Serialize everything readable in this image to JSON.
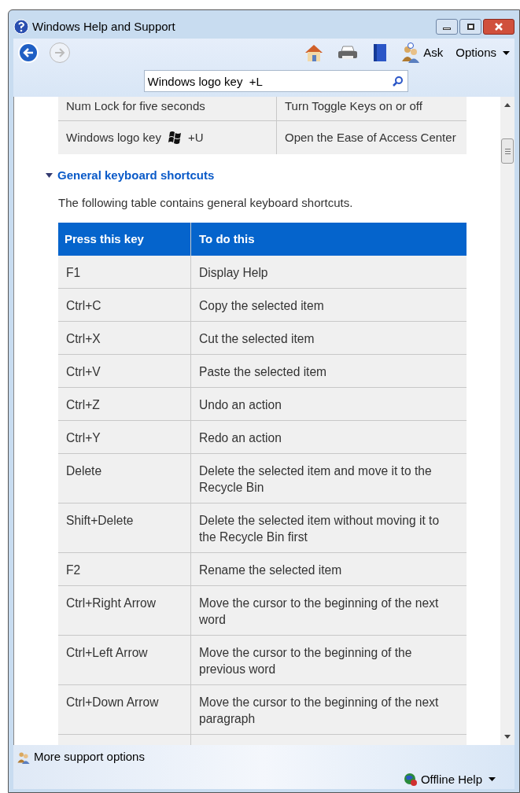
{
  "window": {
    "title": "Windows Help and Support"
  },
  "toolbar": {
    "ask": "Ask",
    "options": "Options"
  },
  "search": {
    "value": "Windows logo key  +L"
  },
  "prev_table": {
    "rows": [
      {
        "key": "Num Lock for five seconds",
        "action": "Turn Toggle Keys on or off",
        "logo": false
      },
      {
        "key": "Windows logo key",
        "suffix": "+U",
        "action": "Open the Ease of Access Center",
        "logo": true
      }
    ]
  },
  "section": {
    "title": "General keyboard shortcuts",
    "expanded": true,
    "intro": "The following table contains general keyboard shortcuts."
  },
  "table": {
    "columns": [
      "Press this key",
      "To do this"
    ],
    "rows": [
      {
        "key": "F1",
        "action": "Display Help"
      },
      {
        "key": "Ctrl+C",
        "action": "Copy the selected item"
      },
      {
        "key": "Ctrl+X",
        "action": "Cut the selected item"
      },
      {
        "key": "Ctrl+V",
        "action": "Paste the selected item"
      },
      {
        "key": "Ctrl+Z",
        "action": "Undo an action"
      },
      {
        "key": "Ctrl+Y",
        "action": "Redo an action"
      },
      {
        "key": "Delete",
        "action": "Delete the selected item and move it to the Recycle Bin"
      },
      {
        "key": "Shift+Delete",
        "action": "Delete the selected item without moving it to the Recycle Bin first"
      },
      {
        "key": "F2",
        "action": "Rename the selected item"
      },
      {
        "key": "Ctrl+Right Arrow",
        "action": "Move the cursor to the beginning of the next word"
      },
      {
        "key": "Ctrl+Left Arrow",
        "action": "Move the cursor to the beginning of the previous word"
      },
      {
        "key": "Ctrl+Down Arrow",
        "action": "Move the cursor to the beginning of the next paragraph"
      }
    ]
  },
  "footer": {
    "more": "More support options",
    "offline": "Offline Help"
  }
}
